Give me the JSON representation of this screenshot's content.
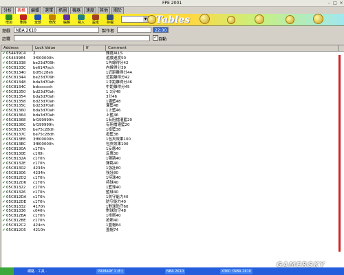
{
  "window": {
    "title": "FPE 2001"
  },
  "tabs": [
    {
      "label": "分析",
      "active": false
    },
    {
      "label": "表格",
      "active": true
    },
    {
      "label": "編輯",
      "active": false
    },
    {
      "label": "選擇",
      "active": false
    },
    {
      "label": "抓圖",
      "active": false
    },
    {
      "label": "機器",
      "active": false
    },
    {
      "label": "速度",
      "active": false
    },
    {
      "label": "其他",
      "active": false
    },
    {
      "label": "關於",
      "active": false
    }
  ],
  "toolbar": {
    "buttons": [
      {
        "label": "增加",
        "icon": "add-icon"
      },
      {
        "label": "刪除",
        "icon": "delete-icon"
      },
      {
        "label": "全部",
        "icon": "select-all-icon"
      },
      {
        "label": "修改",
        "icon": "modify-icon"
      },
      {
        "label": "編輯",
        "icon": "edit-icon"
      },
      {
        "label": "寫入",
        "icon": "write-icon"
      },
      {
        "label": "設定",
        "icon": "settings-icon"
      },
      {
        "label": "存檔",
        "icon": "save-icon"
      }
    ],
    "select_value": "",
    "logo_text": "Tables"
  },
  "form": {
    "game_label": "遊戲",
    "game_value": "NBA 2K10",
    "maker_label": "製作者",
    "maker_value": "",
    "time_value": "22:00",
    "note_label": "註釋",
    "note_value": "",
    "auto_label": "自動",
    "auto_checked": true
  },
  "table": {
    "columns": [
      "Address",
      "Lock Value",
      "If",
      "Comment"
    ],
    "rows": [
      {
        "addr": "054439C4",
        "val": "2",
        "com": "難度ALLS"
      },
      {
        "addr": "054439E4",
        "val": "3f000000h",
        "com": "遊戲速度50"
      },
      {
        "addr": "05C81338",
        "val": "be23d709h",
        "com": "1內線得分42"
      },
      {
        "addr": "05C8133C",
        "val": "be6147ach",
        "com": "內線得分39"
      },
      {
        "addr": "05C81340",
        "val": "bdf5c28eh",
        "com": "1近距離得分44"
      },
      {
        "addr": "05C81344",
        "val": "be23d709h",
        "com": "近距離得分42"
      },
      {
        "addr": "05C81348",
        "val": "bda3d70ah",
        "com": "1中距離得分46"
      },
      {
        "addr": "05C8134C",
        "val": "bdcccccch",
        "com": "中距離得分45"
      },
      {
        "addr": "05C81350",
        "val": "bd23d70ah",
        "com": "1 3分48"
      },
      {
        "addr": "05C81354",
        "val": "bda3d70ah",
        "com": "3分46"
      },
      {
        "addr": "05C81358",
        "val": "bd23d70ah",
        "com": "1灌籃48"
      },
      {
        "addr": "05C8135C",
        "val": "bd23d70ah",
        "com": "灌籃48"
      },
      {
        "addr": "05C81360",
        "val": "bda3d70ah",
        "com": "1上籃46"
      },
      {
        "addr": "05C81364",
        "val": "bda3d70ah",
        "com": "上籃46"
      },
      {
        "addr": "05C81368",
        "val": "bf199999h",
        "com": "1有阻擋灌籃20"
      },
      {
        "addr": "05C8136C",
        "val": "bf199999h",
        "com": "有阻擋灌籃20"
      },
      {
        "addr": "05C81378",
        "val": "be75c28dh",
        "com": "1投籃38"
      },
      {
        "addr": "05C8137C",
        "val": "be75c28dh",
        "com": "投籃38"
      },
      {
        "addr": "05C813E8",
        "val": "3f800000h",
        "com": "1包夾效果100"
      },
      {
        "addr": "05C813EC",
        "val": "3f800000h",
        "com": "包夾效果100"
      },
      {
        "addr": "05C8130A",
        "val": "c170h",
        "com": "1反應40"
      },
      {
        "addr": "05C8130E",
        "val": "c1f0h",
        "com": "反應30"
      },
      {
        "addr": "05C8132A",
        "val": "c170h",
        "com": "1彈跳40"
      },
      {
        "addr": "05C8132E",
        "val": "c170h",
        "com": "彈跳40"
      },
      {
        "addr": "05C81302",
        "val": "4234h",
        "com": "1強壯80"
      },
      {
        "addr": "05C81306",
        "val": "4234h",
        "com": "強壯80"
      },
      {
        "addr": "05C812D2",
        "val": "c170h",
        "com": "1持球40"
      },
      {
        "addr": "05C812D6",
        "val": "c170h",
        "com": "持球40"
      },
      {
        "addr": "05C81322",
        "val": "c170h",
        "com": "1籃球40"
      },
      {
        "addr": "05C81326",
        "val": "c170h",
        "com": "籃球40"
      },
      {
        "addr": "05C812DA",
        "val": "c170h",
        "com": "1防守能力40"
      },
      {
        "addr": "05C812DE",
        "val": "c170h",
        "com": "防守能力40"
      },
      {
        "addr": "05C81332",
        "val": "4170h",
        "com": "1對球防守60"
      },
      {
        "addr": "05C81336",
        "val": "c040h",
        "com": "對球防守48"
      },
      {
        "addr": "05C812BA",
        "val": "c170h",
        "com": "1抢断40"
      },
      {
        "addr": "05C812BE",
        "val": "c170h",
        "com": "抢断40"
      },
      {
        "addr": "05C812C2",
        "val": "424ch",
        "com": "1蓋帽84"
      },
      {
        "addr": "05C812C6",
        "val": "4210h",
        "com": "蓋帽74"
      }
    ]
  },
  "taskbar": {
    "items": [
      "網路 · 工具 ·",
      "PRIMARY 1 (E:)",
      "NBA 2K10",
      "X360《NBA 2K10"
    ]
  },
  "watermark": "GAMERSKY",
  "colors": {
    "active_tab_text": "#cc0000",
    "check": "#1a9a1a",
    "accent_bar": "#d02020",
    "time_bg": "#3264c8"
  }
}
